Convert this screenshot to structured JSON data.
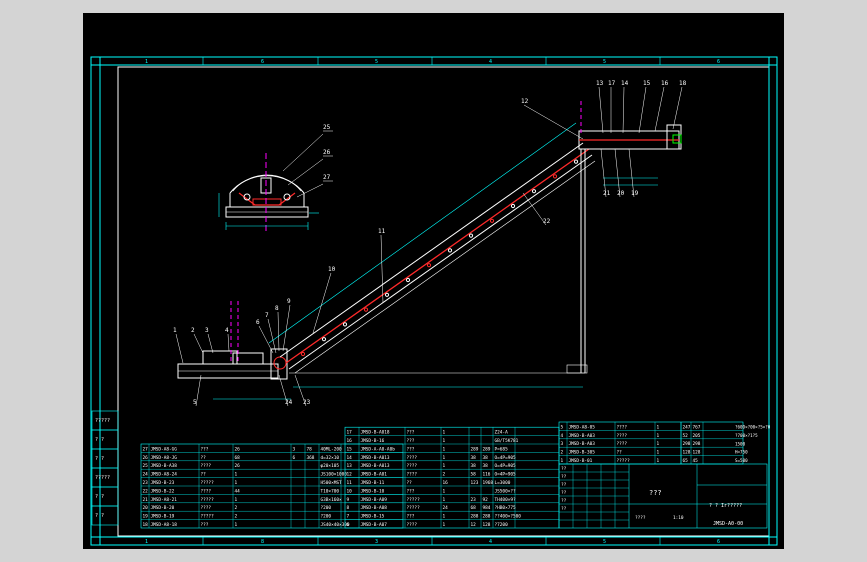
{
  "colors": {
    "background": "#000000",
    "frame": "#00ffff",
    "outline": "#ffffff",
    "belt": "#ff2a2a",
    "dimension": "#00ffff",
    "leader": "#ffffff",
    "centerline": "#ff00ff",
    "text": "#ffffff"
  },
  "frame_zone_labels": {
    "top": [
      "1",
      "6",
      "5",
      "4",
      "5",
      "6"
    ],
    "bottom": [
      "1",
      "8",
      "3",
      "4",
      "5",
      "6"
    ]
  },
  "cross_section_labels": [
    "25",
    "26",
    "27"
  ],
  "main_labels": [
    "1",
    "2",
    "3",
    "4",
    "5",
    "6",
    "7",
    "8",
    "9",
    "10",
    "11",
    "12",
    "13",
    "17",
    "14",
    "15",
    "16",
    "18",
    "21",
    "20",
    "19",
    "22",
    "24",
    "23"
  ],
  "left_stamp": [
    "?????",
    "? ?",
    "? ?",
    "?????",
    "? ?",
    "? ?"
  ],
  "bom_left": [
    [
      "27",
      "JMSD-A8-GG",
      "???",
      "26",
      "3",
      "78",
      "40ML-200"
    ],
    [
      "26",
      "JMSD-A8-JG",
      "??",
      "68",
      "6",
      "368",
      "d=32×10"
    ],
    [
      "25",
      "JMSD-B-A38",
      "????",
      "26",
      "",
      "",
      "φ20×105"
    ],
    [
      "24",
      "JMSD-A8-24",
      "??",
      "1",
      "",
      "",
      "JS100×1000"
    ],
    [
      "23",
      "JMSD-B-23",
      "?????",
      "1",
      "",
      "",
      "H500×MST"
    ],
    [
      "22",
      "JMSD-B-22",
      "????",
      "44",
      "",
      "",
      "T10×700"
    ],
    [
      "21",
      "JMSD-A8-21",
      "?????",
      "1",
      "",
      "",
      "G3B×160×"
    ],
    [
      "20",
      "JMSD-B-20",
      "????",
      "2",
      "",
      "",
      "?200"
    ],
    [
      "19",
      "JMSD-B-19",
      "?????",
      "2",
      "",
      "",
      "?200"
    ],
    [
      "18",
      "JMSD-A8-18",
      "???",
      "1",
      "",
      "",
      "JS40×40×300"
    ]
  ],
  "bom_mid": [
    [
      "17",
      "JMSD-B-A018",
      "???",
      "1",
      "",
      "",
      "Z24-A"
    ],
    [
      "16",
      "JMSD-B-16",
      "???",
      "1",
      "",
      "",
      "GB/T5K781"
    ],
    [
      "15",
      "JMSD-A-A0-A0b",
      "???",
      "1",
      "289",
      "289",
      "P=685"
    ],
    [
      "14",
      "JMSD-B-A013",
      "????",
      "1",
      "38",
      "38",
      "O=4P=905"
    ],
    [
      "13",
      "JMSD-B-A013",
      "????",
      "1",
      "38",
      "38",
      "O=4P=905"
    ],
    [
      "12",
      "JMSD-B-A01",
      "????",
      "2",
      "58",
      "116",
      "O=4P=905"
    ],
    [
      "11",
      "JMSD-B-11",
      "??",
      "16",
      "123",
      "1968",
      "L=3000"
    ],
    [
      "10",
      "JMSD-B-10",
      "???",
      "1",
      "",
      "",
      "JS500×??"
    ],
    [
      "9",
      "JMSD-B-A09",
      "?????",
      "1",
      "23",
      "92",
      "TH400×9?"
    ],
    [
      "8",
      "JMSD-B-A08",
      "?????",
      "24",
      "68",
      "984",
      "?HB0×775"
    ],
    [
      "7",
      "JMSD-B-15",
      "???",
      "1",
      "288",
      "288",
      "??400×?500"
    ],
    [
      "6",
      "JMSD-B-A07",
      "????",
      "1",
      "12",
      "128",
      "?7200"
    ]
  ],
  "bom_right": [
    [
      "5",
      "JMSD-A8-05",
      "????",
      "1",
      "",
      "",
      "247",
      "767"
    ],
    [
      "4",
      "JMSD-B-A03",
      "????",
      "1",
      "",
      "",
      "52",
      "205"
    ],
    [
      "3",
      "JMSD-B-A03",
      "????",
      "1",
      "",
      "",
      "298",
      "298"
    ],
    [
      "2",
      "JMSD-B-305",
      "??",
      "1",
      "",
      "",
      "128",
      "128"
    ],
    [
      "1",
      "JMSD-B-01",
      "?????",
      "1",
      "",
      "",
      "65",
      "45"
    ]
  ],
  "bom_right_spec": [
    "?60D×?00×?5×?0",
    "?700×?1?5",
    "1500",
    "H=750",
    "S=500"
  ],
  "title_block": {
    "company": "???",
    "drawing_name": "? ? Ir?????",
    "drawing_no": "JMSD-A0-00",
    "scale": "1:10",
    "sheet": "????",
    "signature_labels": [
      "??",
      "??",
      "??",
      "??",
      "??",
      "??"
    ]
  }
}
